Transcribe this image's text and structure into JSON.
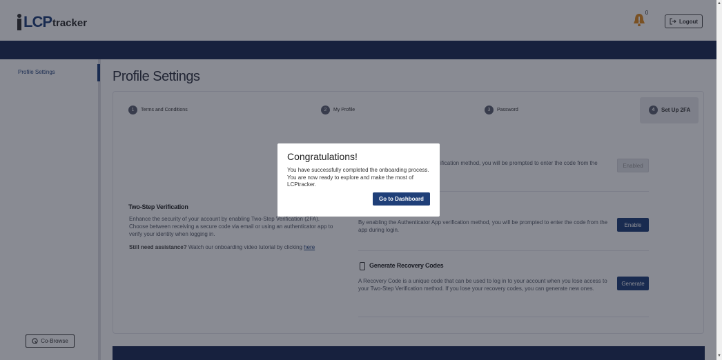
{
  "header": {
    "logo": {
      "brand": "LCP",
      "suffix": "tracker"
    },
    "notification_count": "0",
    "logout_label": "Logout"
  },
  "sidebar": {
    "items": [
      {
        "label": "Profile Settings",
        "active": true
      }
    ],
    "cobrowse_label": "Co-Browse"
  },
  "main": {
    "title": "Profile Settings",
    "steps": [
      {
        "num": "1",
        "label": "Terms and Conditions"
      },
      {
        "num": "2",
        "label": "My Profile"
      },
      {
        "num": "3",
        "label": "Password"
      },
      {
        "num": "4",
        "label": "Set Up 2FA",
        "active": true
      }
    ],
    "two_step": {
      "heading": "Two-Step Verification",
      "description": "Enhance the security of your account by enabling Two-Step Verification (2FA). Choose between receiving a secure code via email or using an authenticator app to verify your identity when logging in.",
      "assist_bold": "Still need assistance?",
      "assist_text": " Watch our onboarding video tutorial by clicking ",
      "assist_link": "here"
    },
    "methods": [
      {
        "text": "ification method, you will be prompted to enter the code from the",
        "button": "Enabled"
      },
      {
        "text": "By enabling the Authenticator App verification method, you will be prompted to enter the code from the app during login.",
        "button": "Enable"
      },
      {
        "heading": "Generate Recovery Codes",
        "text": "A Recovery Code is a unique code that can be used to log in to your account when you lose access to your Two-Step Verification method. If you lose your recovery codes, you can generate new ones.",
        "button": "Generate"
      }
    ]
  },
  "modal": {
    "title": "Congratulations!",
    "message": "You have successfully completed the onboarding process. You are now ready to explore and make the most of LCPtracker.",
    "button": "Go to Dashboard"
  },
  "colors": {
    "navy": "#1a2a55",
    "brand_blue": "#1f3f78"
  }
}
